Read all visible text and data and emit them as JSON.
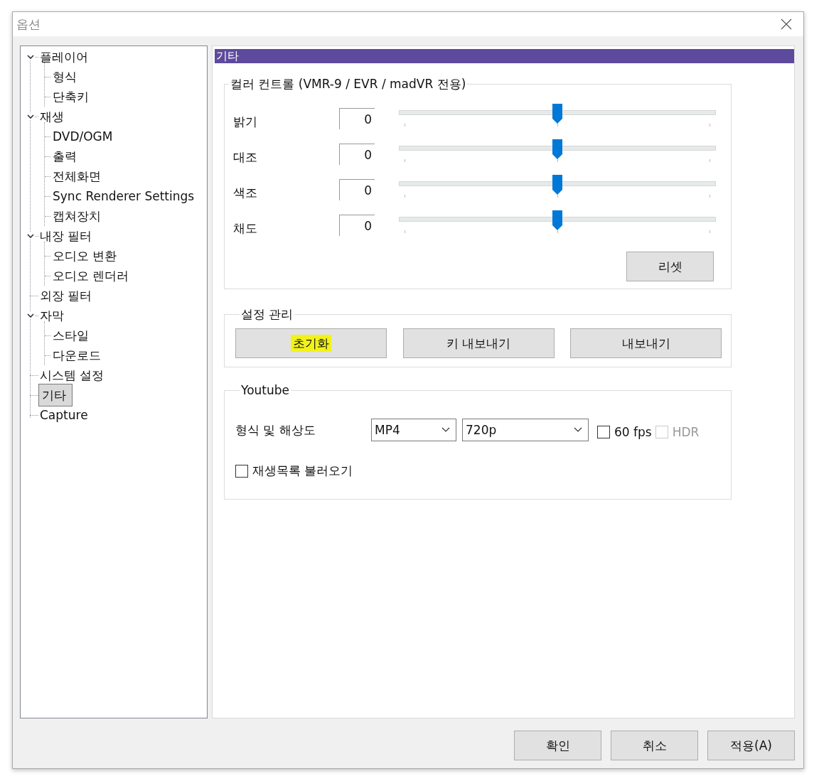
{
  "window": {
    "title": "옵션"
  },
  "sidebar": {
    "items": [
      {
        "label": "플레이어",
        "expanded": true,
        "selected": false,
        "children": [
          {
            "label": "형식",
            "selected": false
          },
          {
            "label": "단축키",
            "selected": false
          }
        ]
      },
      {
        "label": "재생",
        "expanded": true,
        "selected": false,
        "children": [
          {
            "label": "DVD/OGM",
            "selected": false
          },
          {
            "label": "출력",
            "selected": false
          },
          {
            "label": "전체화면",
            "selected": false
          },
          {
            "label": "Sync Renderer Settings",
            "selected": false
          },
          {
            "label": "캡쳐장치",
            "selected": false
          }
        ]
      },
      {
        "label": "내장 필터",
        "expanded": true,
        "selected": false,
        "children": [
          {
            "label": "오디오 변환",
            "selected": false
          },
          {
            "label": "오디오 렌더러",
            "selected": false
          }
        ]
      },
      {
        "label": "외장 필터",
        "selected": false
      },
      {
        "label": "자막",
        "expanded": true,
        "selected": false,
        "children": [
          {
            "label": "스타일",
            "selected": false
          },
          {
            "label": "다운로드",
            "selected": false
          }
        ]
      },
      {
        "label": "시스템 설정",
        "selected": false
      },
      {
        "label": "기타",
        "selected": true
      },
      {
        "label": "Capture",
        "selected": false
      }
    ]
  },
  "page": {
    "header": "기타"
  },
  "color_control": {
    "title": "컬러 컨트롤 (VMR-9 / EVR / madVR 전용)",
    "rows": [
      {
        "label": "밝기",
        "value": "0",
        "level": 0.5
      },
      {
        "label": "대조",
        "value": "0",
        "level": 0.5
      },
      {
        "label": "색조",
        "value": "0",
        "level": 0.5
      },
      {
        "label": "채도",
        "value": "0",
        "level": 0.5
      }
    ],
    "reset": "리셋"
  },
  "settings_management": {
    "title": "설정 관리",
    "buttons": [
      {
        "label": "초기화",
        "highlighted": true
      },
      {
        "label": "키 내보내기",
        "highlighted": false
      },
      {
        "label": "내보내기",
        "highlighted": false
      }
    ]
  },
  "youtube": {
    "title": "Youtube",
    "format_label": "형식 및 해상도",
    "format": {
      "value": "MP4"
    },
    "resolution": {
      "value": "720p"
    },
    "fps60": {
      "label": "60 fps",
      "checked": false,
      "disabled": false
    },
    "hdr": {
      "label": "HDR",
      "checked": false,
      "disabled": true
    },
    "playlist": {
      "label": "재생목록 불러오기",
      "checked": false,
      "disabled": false
    }
  },
  "buttons": [
    "확인",
    "취소",
    "적용(A)"
  ]
}
